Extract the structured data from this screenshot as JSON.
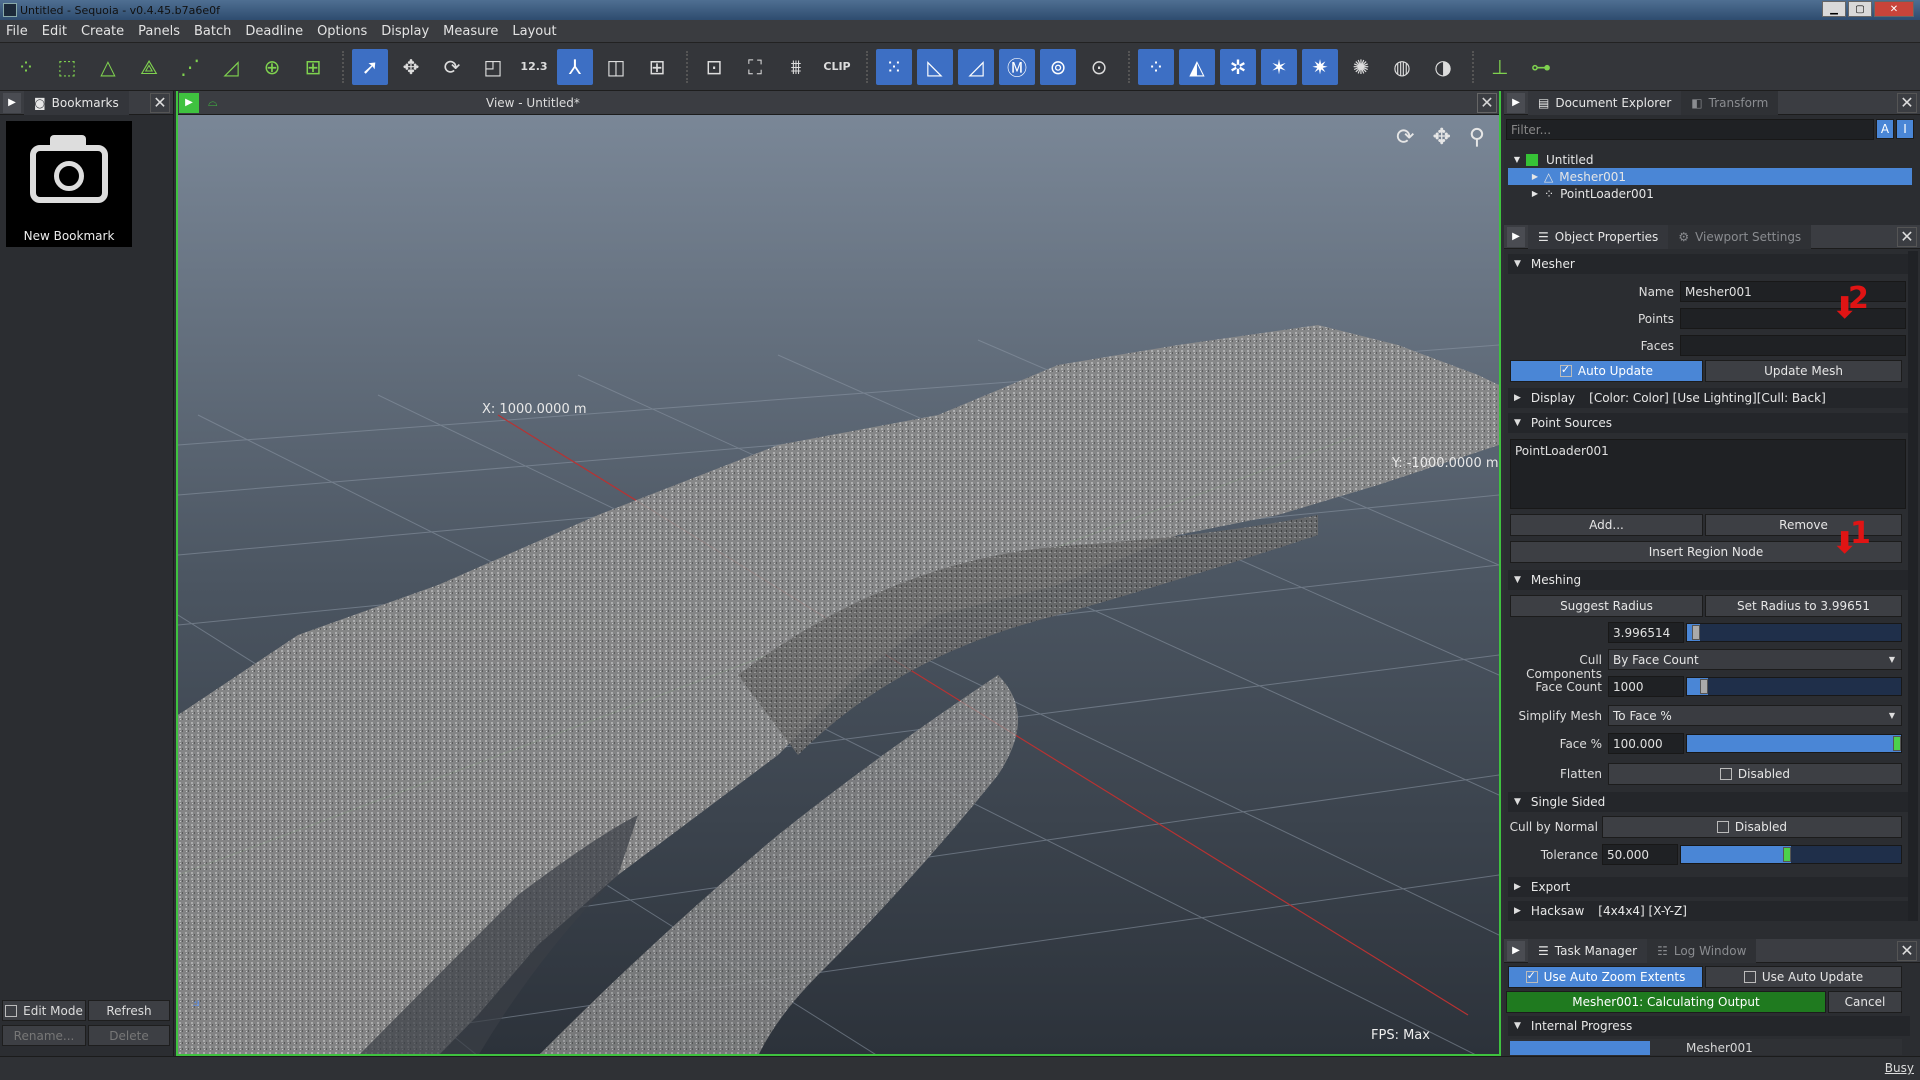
{
  "window": {
    "title": "Untitled - Sequoia - v0.4.45.b7a6e0f"
  },
  "menu": [
    "File",
    "Edit",
    "Create",
    "Panels",
    "Batch",
    "Deadline",
    "Options",
    "Display",
    "Measure",
    "Layout"
  ],
  "toolbar": {
    "icons": [
      "point-loader-icon",
      "mesh-loader-icon",
      "mesher-icon",
      "mesh-icon",
      "filter-icon",
      "cut-icon",
      "add-icon",
      "tree-icon",
      "select-icon",
      "move-icon",
      "rotate-icon",
      "scale-icon",
      "measure-icon",
      "axis-icon",
      "box-icon",
      "grid-icon",
      "focus-icon",
      "camera-icon",
      "tower-icon",
      "clip-icon"
    ],
    "measure_label": "12.3",
    "clip_label": "CLIP"
  },
  "left": {
    "tab": "Bookmarks",
    "bookmark_label": "New Bookmark",
    "edit_mode": "Edit Mode",
    "refresh": "Refresh",
    "rename": "Rename...",
    "delete": "Delete"
  },
  "viewport": {
    "title": "View - Untitled*",
    "x_label": "X: 1000.0000 m",
    "y_label": "Y: -1000.0000 m",
    "fps": "FPS: Max"
  },
  "doc": {
    "tab1": "Document Explorer",
    "tab2": "Transform",
    "filter_placeholder": "Filter...",
    "root": "Untitled",
    "child1": "Mesher001",
    "child2": "PointLoader001"
  },
  "props": {
    "tab1": "Object Properties",
    "tab2": "Viewport Settings",
    "mesher_section": "Mesher",
    "name_label": "Name",
    "name_value": "Mesher001",
    "points_label": "Points",
    "faces_label": "Faces",
    "auto_update": "Auto Update",
    "update_mesh": "Update Mesh",
    "display_section": "Display",
    "display_summary": "[Color: Color] [Use Lighting][Cull: Back]",
    "sources_section": "Point Sources",
    "source_item": "PointLoader001",
    "add": "Add...",
    "remove": "Remove",
    "insert_region": "Insert Region Node",
    "meshing_section": "Meshing",
    "suggest_radius": "Suggest Radius",
    "set_radius": "Set Radius to 3.99651",
    "radius_label": "Radius",
    "radius_value": "3.996514",
    "cull_label": "Cull Components",
    "cull_value": "By Face Count",
    "facecount_label": "Face Count",
    "facecount_value": "1000",
    "simplify_label": "Simplify Mesh",
    "simplify_value": "To Face %",
    "facepct_label": "Face %",
    "facepct_value": "100.000",
    "flatten_label": "Flatten",
    "flatten_value": "Disabled",
    "single_sided_section": "Single Sided",
    "cull_normal_label": "Cull by Normal",
    "cull_normal_value": "Disabled",
    "tolerance_label": "Tolerance",
    "tolerance_value": "50.000",
    "export_section": "Export",
    "hacksaw_section": "Hacksaw",
    "hacksaw_summary": "[4x4x4] [X-Y-Z]",
    "radius_fill": 0.06,
    "facecount_fill": 0.1,
    "facepct_fill": 1.0,
    "tolerance_fill": 0.5
  },
  "annotations": {
    "arrow1": "1",
    "arrow2": "2"
  },
  "tasks": {
    "tab1": "Task Manager",
    "tab2": "Log Window",
    "auto_zoom": "Use Auto Zoom Extents",
    "auto_update": "Use Auto Update",
    "task_status": "Mesher001: Calculating Output",
    "cancel": "Cancel",
    "internal_progress": "Internal Progress",
    "progress_item": "Mesher001"
  },
  "status": {
    "busy": "Busy"
  }
}
